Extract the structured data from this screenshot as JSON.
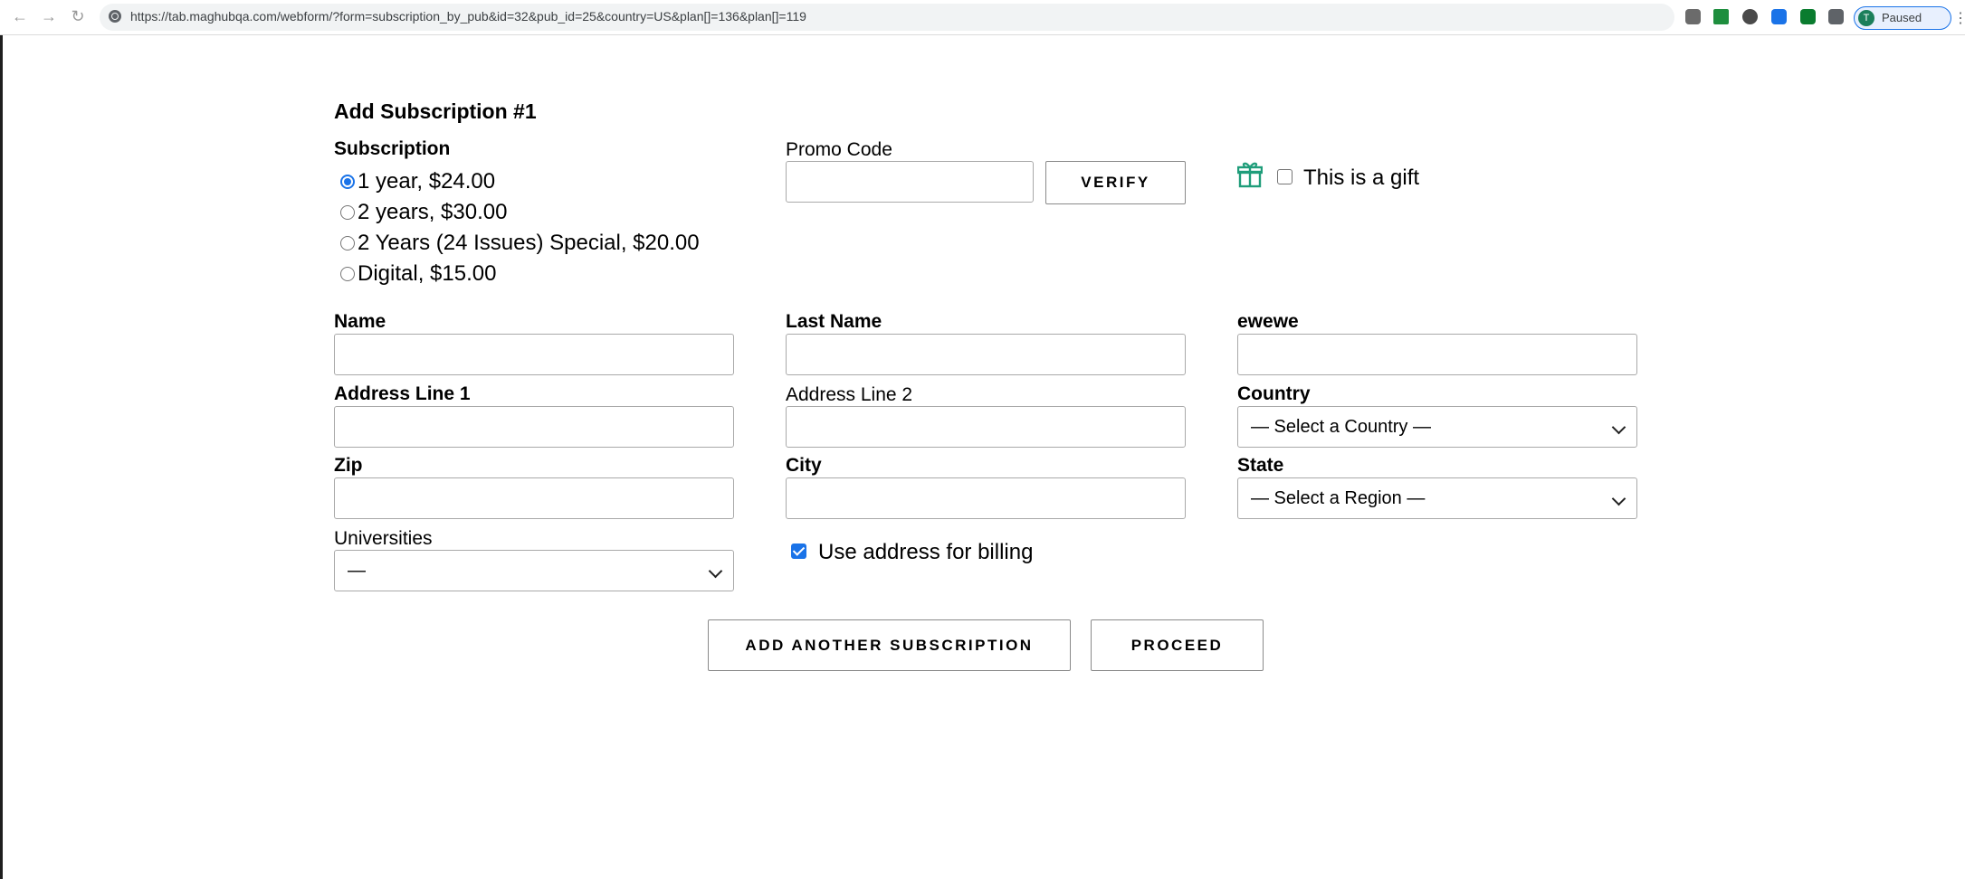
{
  "browser": {
    "url": "https://tab.maghubqa.com/webform/?form=subscription_by_pub&id=32&pub_id=25&country=US&plan[]=136&plan[]=119",
    "profile_label": "Paused",
    "profile_initial": "T",
    "nav_icons": [
      "back-icon",
      "forward-icon",
      "reload-icon"
    ],
    "extension_colors": [
      "#6b6b6b",
      "#1e8e3e",
      "#4a4a4a",
      "#1a73e8",
      "#0a7c2f",
      "#5f6368"
    ]
  },
  "form": {
    "title": "Add Subscription #1",
    "subscription_label": "Subscription",
    "plans": [
      {
        "label": "1 year, $24.00",
        "selected": true
      },
      {
        "label": "2 years, $30.00",
        "selected": false
      },
      {
        "label": "2 Years (24 Issues) Special, $20.00",
        "selected": false
      },
      {
        "label": "Digital, $15.00",
        "selected": false
      }
    ],
    "promo_label": "Promo Code",
    "promo_value": "",
    "verify_button": "VERIFY",
    "gift_label": "This is a gift",
    "gift_checked": false,
    "name_label": "Name",
    "last_name_label": "Last Name",
    "custom_label": "ewewe",
    "address1_label": "Address Line 1",
    "address2_label": "Address Line 2",
    "country_label": "Country",
    "country_value": "— Select a Country —",
    "zip_label": "Zip",
    "city_label": "City",
    "state_label": "State",
    "state_value": "— Select a Region —",
    "universities_label": "Universities",
    "universities_value": "—",
    "billing_label": "Use address for billing",
    "billing_checked": true,
    "add_another_button": "ADD ANOTHER SUBSCRIPTION",
    "proceed_button": "PROCEED"
  },
  "colors": {
    "accent": "#1a73e8",
    "gift_icon": "#1f9d7a"
  }
}
